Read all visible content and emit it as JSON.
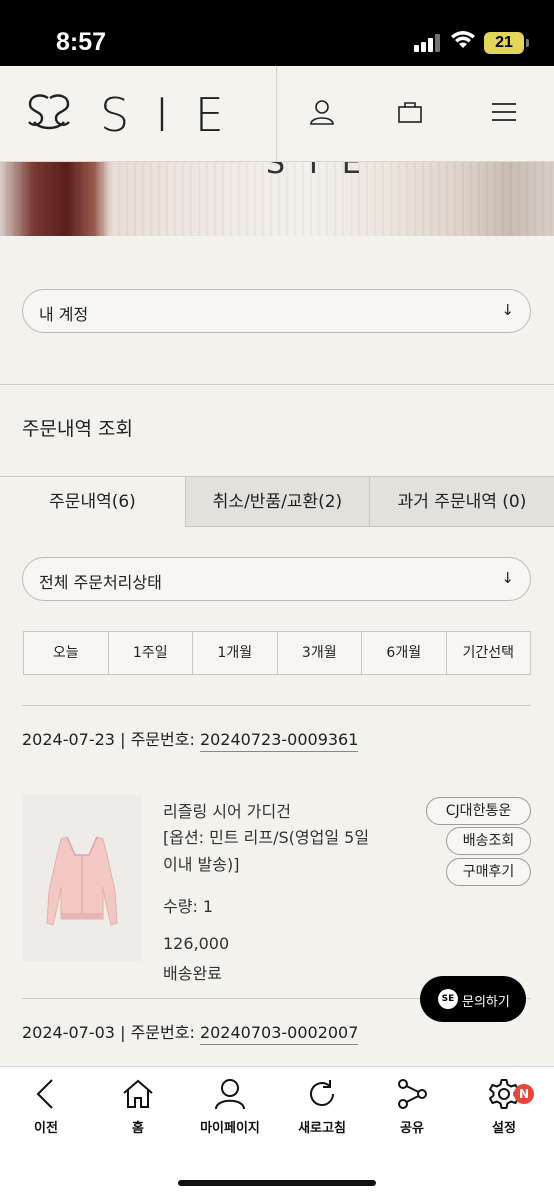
{
  "status_bar": {
    "time": "8:57",
    "battery": "21"
  },
  "header": {
    "brand": "SIE",
    "icons": [
      "user-icon",
      "bag-icon",
      "menu-icon"
    ]
  },
  "banner": {
    "text": "SIE"
  },
  "account_select": {
    "label": "내 계정",
    "arrow": "↓"
  },
  "section": {
    "title": "주문내역 조회"
  },
  "tabs": [
    {
      "label": "주문내역(6)",
      "active": true
    },
    {
      "label": "취소/반품/교환(2)",
      "active": false
    },
    {
      "label": "과거 주문내역 (0)",
      "active": false
    }
  ],
  "status_filter": {
    "label": "전체 주문처리상태",
    "arrow": "↓"
  },
  "periods": [
    "오늘",
    "1주일",
    "1개월",
    "3개월",
    "6개월",
    "기간선택"
  ],
  "orders": [
    {
      "date": "2024-07-23",
      "order_label": "주문번호:",
      "order_number": "20240723-0009361",
      "product": {
        "name": "리즐링 시어 가디건",
        "option_line1": "[옵션: 민트 리프/S(영업일 5일",
        "option_line2": "이내 발송)]",
        "quantity": "수량: 1",
        "price": "126,000",
        "status": "배송완료"
      },
      "chips": [
        "CJ대한통운",
        "배송조회",
        "구매후기"
      ]
    },
    {
      "date": "2024-07-03",
      "order_label": "주문번호:",
      "order_number": "20240703-0002007"
    }
  ],
  "inquiry_button": {
    "label": "문의하기",
    "logo": "SE"
  },
  "bottom_bar": [
    {
      "label": "이전",
      "icon": "back-icon"
    },
    {
      "label": "홈",
      "icon": "home-icon"
    },
    {
      "label": "마이페이지",
      "icon": "person-icon"
    },
    {
      "label": "새로고침",
      "icon": "refresh-icon"
    },
    {
      "label": "공유",
      "icon": "share-icon"
    },
    {
      "label": "설정",
      "icon": "gear-icon",
      "badge": "N"
    }
  ],
  "colors": {
    "background": "#f3f2ed",
    "tab_inactive": "#e2e1dc",
    "badge": "#e8453c",
    "battery": "#e3d45a"
  }
}
